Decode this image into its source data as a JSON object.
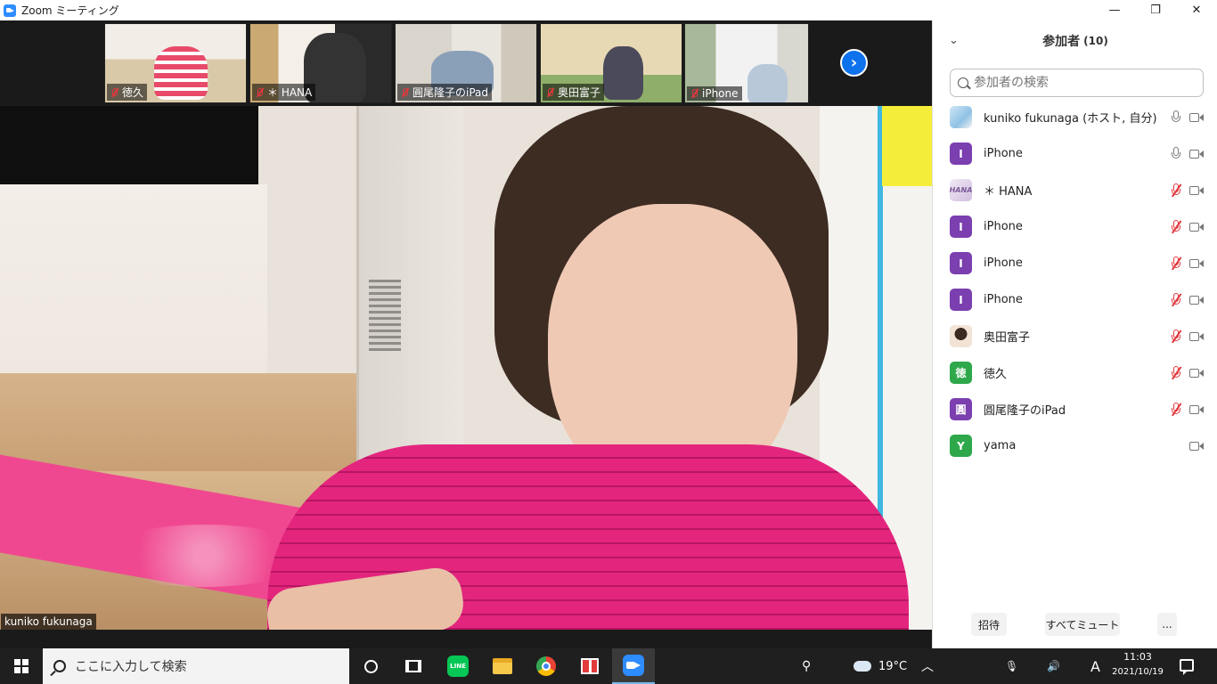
{
  "window": {
    "title": "Zoom ミーティング"
  },
  "window_controls": {
    "minimize": "—",
    "restore": "❐",
    "close": "✕"
  },
  "thumbnails": [
    {
      "name": "徳久",
      "muted": true
    },
    {
      "name": "＊ HANA",
      "muted": true
    },
    {
      "name": "圓尾隆子のiPad",
      "muted": true
    },
    {
      "name": "奥田富子",
      "muted": true
    },
    {
      "name": "iPhone",
      "muted": true
    }
  ],
  "next_page": "›",
  "main_video": {
    "name": "kuniko fukunaga"
  },
  "panel": {
    "collapse": "⌄",
    "title": "参加者",
    "count": "(10)",
    "search_placeholder": "参加者の検索",
    "participants": [
      {
        "name": "kuniko fukunaga (ホスト, 自分)",
        "avatar": "",
        "avatar_color": "#8fc1e4",
        "muted": false,
        "mic": true
      },
      {
        "name": "iPhone",
        "avatar": "I",
        "avatar_color": "#7b3fb0",
        "muted": false,
        "mic": true
      },
      {
        "name": "＊ HANA",
        "avatar": "HANA",
        "avatar_color": "#d2bfe0",
        "muted": true,
        "mic": true
      },
      {
        "name": "iPhone",
        "avatar": "I",
        "avatar_color": "#7b3fb0",
        "muted": true,
        "mic": true
      },
      {
        "name": "iPhone",
        "avatar": "I",
        "avatar_color": "#7b3fb0",
        "muted": true,
        "mic": true
      },
      {
        "name": "iPhone",
        "avatar": "I",
        "avatar_color": "#7b3fb0",
        "muted": true,
        "mic": true
      },
      {
        "name": "奥田富子",
        "avatar": "",
        "avatar_color": "#f2e3d5",
        "muted": true,
        "mic": true
      },
      {
        "name": "徳久",
        "avatar": "徳",
        "avatar_color": "#2ea84a",
        "muted": true,
        "mic": true
      },
      {
        "name": "圓尾隆子のiPad",
        "avatar": "圓",
        "avatar_color": "#7b3fb0",
        "muted": true,
        "mic": true
      },
      {
        "name": "yama",
        "avatar": "Y",
        "avatar_color": "#2ea84a",
        "muted": false,
        "mic": false
      }
    ],
    "footer": {
      "invite": "招待",
      "mute_all": "すべてミュート",
      "more": "..."
    }
  },
  "taskbar": {
    "search_placeholder": "ここに入力して検索",
    "line_label": "LINE",
    "temperature": "19°C",
    "time": "11:03",
    "date": "2021/10/19",
    "ime": "A",
    "tray_glyphs": {
      "people": "⚲",
      "chevron": "︿",
      "volume": "🔊",
      "mic": "🎙"
    }
  },
  "colors": {
    "accent": "#0e72ed",
    "muted": "#e0383e",
    "zoom_blue": "#2d8cff"
  }
}
